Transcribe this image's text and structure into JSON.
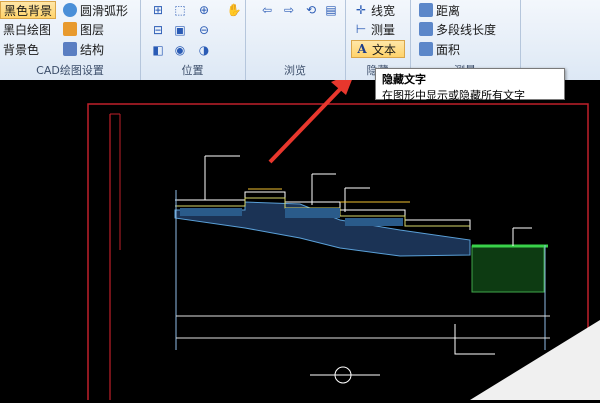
{
  "ribbon": {
    "group_cad": {
      "label": "CAD绘图设置",
      "items": [
        "黑色背景",
        "黑白绘图",
        "背景色"
      ],
      "items2": [
        "圆滑弧形",
        "图层",
        "结构"
      ]
    },
    "group_position": {
      "label": "位置"
    },
    "group_browse": {
      "label": "浏览"
    },
    "group_hide": {
      "label": "隐藏",
      "items": [
        "线宽",
        "测量",
        "文本"
      ]
    },
    "group_measure": {
      "label": "测量",
      "items": [
        "距离",
        "多段线长度",
        "面积"
      ]
    }
  },
  "tooltip": {
    "title": "隐藏文字",
    "desc": "在图形中显示或隐藏所有文字"
  },
  "colors": {
    "arrow": "#e8372d",
    "frame": "#c0202a",
    "active": "#ffd36b"
  }
}
